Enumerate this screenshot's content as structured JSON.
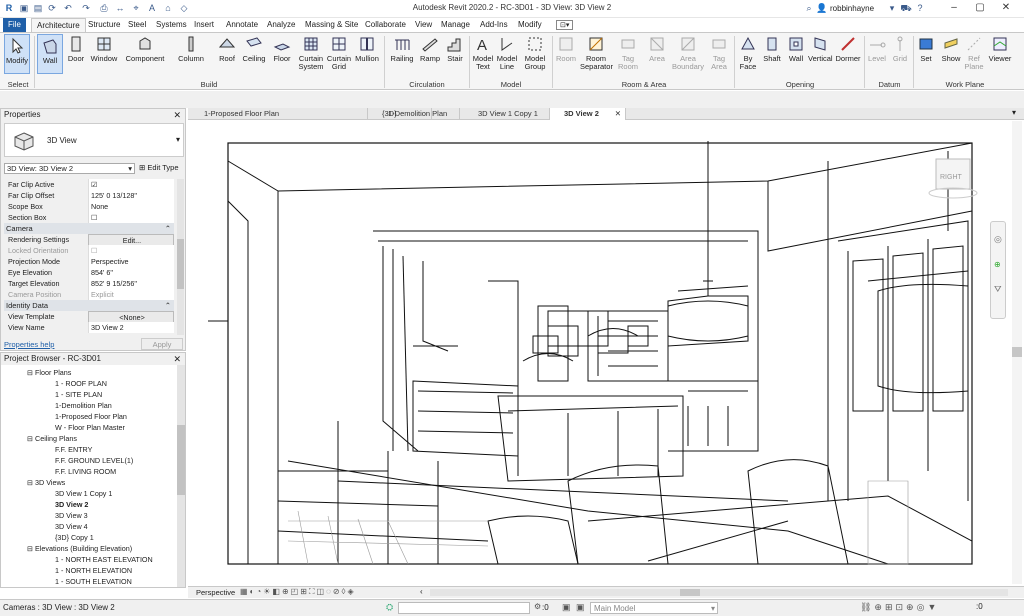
{
  "app": {
    "title": "Autodesk Revit 2020.2 - RC-3D01 - 3D View: 3D View 2",
    "user": "robbinhayne"
  },
  "menu": {
    "tabs": [
      "File",
      "Architecture",
      "Structure",
      "Steel",
      "Systems",
      "Insert",
      "Annotate",
      "Analyze",
      "Massing & Site",
      "Collaborate",
      "View",
      "Manage",
      "Add-Ins",
      "Modify"
    ],
    "active": "Architecture"
  },
  "ribbon": {
    "buttons": [
      {
        "label": "Modify",
        "icon": "modify-cursor-icon"
      },
      {
        "label": "Wall",
        "icon": "wall-icon"
      },
      {
        "label": "Door",
        "icon": "door-icon"
      },
      {
        "label": "Window",
        "icon": "window-icon"
      },
      {
        "label": "Component",
        "icon": "component-icon"
      },
      {
        "label": "Column",
        "icon": "column-icon"
      },
      {
        "label": "Roof",
        "icon": "roof-icon"
      },
      {
        "label": "Ceiling",
        "icon": "ceiling-icon"
      },
      {
        "label": "Floor",
        "icon": "floor-icon"
      },
      {
        "label": "Curtain System",
        "icon": "curtain-system-icon"
      },
      {
        "label": "Curtain Grid",
        "icon": "curtain-grid-icon"
      },
      {
        "label": "Mullion",
        "icon": "mullion-icon"
      },
      {
        "label": "Railing",
        "icon": "railing-icon"
      },
      {
        "label": "Ramp",
        "icon": "ramp-icon"
      },
      {
        "label": "Stair",
        "icon": "stair-icon"
      },
      {
        "label": "Model Text",
        "icon": "model-text-icon"
      },
      {
        "label": "Model Line",
        "icon": "model-line-icon"
      },
      {
        "label": "Model Group",
        "icon": "model-group-icon"
      },
      {
        "label": "Room",
        "icon": "room-icon"
      },
      {
        "label": "Room Separator",
        "icon": "room-separator-icon"
      },
      {
        "label": "Tag Room",
        "icon": "tag-room-icon"
      },
      {
        "label": "Area",
        "icon": "area-icon"
      },
      {
        "label": "Area Boundary",
        "icon": "area-boundary-icon"
      },
      {
        "label": "Tag Area",
        "icon": "tag-area-icon"
      },
      {
        "label": "By Face",
        "icon": "by-face-icon"
      },
      {
        "label": "Shaft",
        "icon": "shaft-icon"
      },
      {
        "label": "Wall",
        "icon": "wall-opening-icon"
      },
      {
        "label": "Vertical",
        "icon": "vertical-icon"
      },
      {
        "label": "Dormer",
        "icon": "dormer-icon"
      },
      {
        "label": "Level",
        "icon": "level-icon"
      },
      {
        "label": "Grid",
        "icon": "grid-icon"
      },
      {
        "label": "Set",
        "icon": "set-icon"
      },
      {
        "label": "Show",
        "icon": "show-icon"
      },
      {
        "label": "Ref Plane",
        "icon": "ref-plane-icon"
      },
      {
        "label": "Viewer",
        "icon": "viewer-icon"
      }
    ],
    "panels": [
      "Select",
      "Build",
      "Circulation",
      "Model",
      "Room & Area",
      "Opening",
      "Datum",
      "Work Plane"
    ]
  },
  "properties": {
    "header": "Properties",
    "type_name": "3D View",
    "selector": "3D View: 3D View 2",
    "edit_type": "Edit Type",
    "rows": [
      {
        "k": "Far Clip Active",
        "v": "☑"
      },
      {
        "k": "Far Clip Offset",
        "v": "125'  0 13/128\""
      },
      {
        "k": "Scope Box",
        "v": "None"
      },
      {
        "k": "Section Box",
        "v": "☐"
      },
      {
        "k": "Camera",
        "v": ""
      },
      {
        "k": "Rendering Settings",
        "v": "Edit..."
      },
      {
        "k": "Locked Orientation",
        "v": "☐"
      },
      {
        "k": "Projection Mode",
        "v": "Perspective"
      },
      {
        "k": "Eye Elevation",
        "v": "854'  6\""
      },
      {
        "k": "Target Elevation",
        "v": "852'  9 15/256\""
      },
      {
        "k": "Camera Position",
        "v": "Explicit"
      },
      {
        "k": "Identity Data",
        "v": ""
      },
      {
        "k": "View Template",
        "v": "<None>"
      },
      {
        "k": "View Name",
        "v": "3D View 2"
      }
    ],
    "help": "Properties help",
    "apply": "Apply"
  },
  "browser": {
    "header": "Project Browser - RC-3D01",
    "items": [
      {
        "t": "Floor Plans",
        "lvl": 1
      },
      {
        "t": "1 - ROOF PLAN",
        "lvl": 2
      },
      {
        "t": "1 - SITE PLAN",
        "lvl": 2
      },
      {
        "t": "1-Demolition Plan",
        "lvl": 2
      },
      {
        "t": "1-Proposed Floor Plan",
        "lvl": 2
      },
      {
        "t": "W - Floor Plan Master",
        "lvl": 2
      },
      {
        "t": "Ceiling Plans",
        "lvl": 1
      },
      {
        "t": "F.F. ENTRY",
        "lvl": 2
      },
      {
        "t": "F.F. GROUND LEVEL(1)",
        "lvl": 2
      },
      {
        "t": "F.F. LIVING ROOM",
        "lvl": 2
      },
      {
        "t": "3D Views",
        "lvl": 1
      },
      {
        "t": "3D View 1 Copy 1",
        "lvl": 2
      },
      {
        "t": "3D View 2",
        "lvl": 2
      },
      {
        "t": "3D View 3",
        "lvl": 2
      },
      {
        "t": "3D View 4",
        "lvl": 2
      },
      {
        "t": "{3D} Copy 1",
        "lvl": 2
      },
      {
        "t": "Elevations (Building Elevation)",
        "lvl": 1
      },
      {
        "t": "1 - NORTH EAST ELEVATION",
        "lvl": 2
      },
      {
        "t": "1 - NORTH ELEVATION",
        "lvl": 2
      },
      {
        "t": "1 - SOUTH ELEVATION",
        "lvl": 2
      }
    ]
  },
  "view_tabs": [
    "1-Proposed Floor Plan",
    "{3D}",
    "1-Demolition Plan",
    "3D View 1 Copy 1",
    "3D View 2"
  ],
  "viewcube": "RIGHT",
  "viewbar": {
    "mode": "Perspective"
  },
  "status": {
    "text": "Cameras : 3D View : 3D View 2",
    "zero": ":0",
    "model": "Main Model"
  }
}
